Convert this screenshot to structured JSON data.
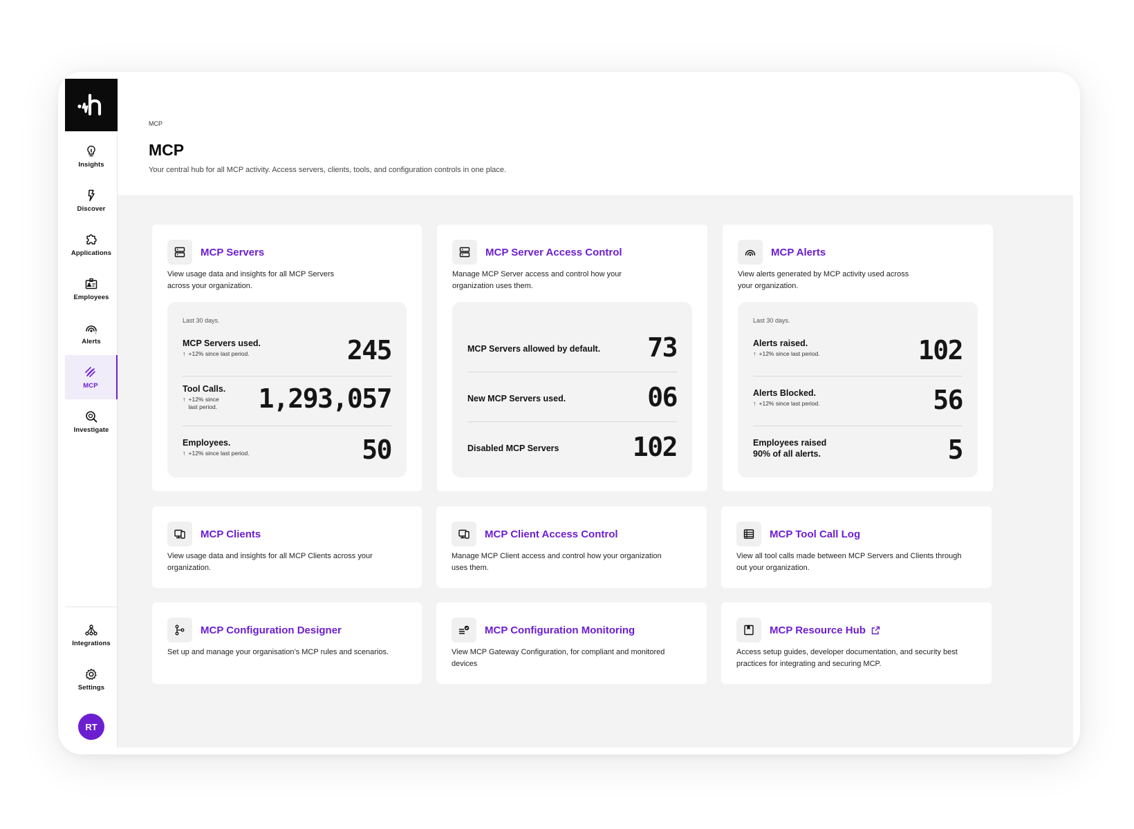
{
  "sidebar": {
    "items": [
      {
        "label": "Insights",
        "icon": "lightbulb-icon"
      },
      {
        "label": "Discover",
        "icon": "bolt-icon"
      },
      {
        "label": "Applications",
        "icon": "puzzle-icon"
      },
      {
        "label": "Employees",
        "icon": "id-card-icon"
      },
      {
        "label": "Alerts",
        "icon": "signal-icon"
      },
      {
        "label": "MCP",
        "icon": "mcp-icon",
        "active": true
      },
      {
        "label": "Investigate",
        "icon": "magnifier-icon"
      }
    ],
    "bottom": [
      {
        "label": "Integrations",
        "icon": "network-icon"
      },
      {
        "label": "Settings",
        "icon": "gear-icon"
      }
    ],
    "avatar": "RT"
  },
  "header": {
    "breadcrumb": "MCP",
    "title": "MCP",
    "subtitle": "Your central hub for all MCP activity. Access servers, clients, tools, and configuration controls in one place."
  },
  "cards": {
    "servers": {
      "title": "MCP Servers",
      "desc1": "View usage data and insights for all MCP Servers",
      "desc2": "across your organization.",
      "period": "Last 30 days.",
      "rows": [
        {
          "label": "MCP Servers used.",
          "sub": "+12% since last period.",
          "value": "245"
        },
        {
          "label": "Tool Calls.",
          "sub1": "+12% since",
          "sub2": "last period.",
          "value": "1,293,057"
        },
        {
          "label": "Employees.",
          "sub": "+12% since last period.",
          "value": "50"
        }
      ]
    },
    "access": {
      "title": "MCP Server Access Control",
      "desc1": "Manage MCP Server access and control how your",
      "desc2": "organization uses them.",
      "rows": [
        {
          "label": "MCP Servers allowed by default.",
          "value": "73"
        },
        {
          "label": "New MCP Servers used.",
          "value": "06"
        },
        {
          "label": "Disabled MCP Servers",
          "value": "102"
        }
      ]
    },
    "alerts": {
      "title": "MCP Alerts",
      "desc1": "View alerts generated by MCP activity used across",
      "desc2": "your organization.",
      "period": "Last 30 days.",
      "rows": [
        {
          "label": "Alerts raised.",
          "sub": "+12% since last period.",
          "value": "102"
        },
        {
          "label": "Alerts Blocked.",
          "sub": "+12% since last period.",
          "value": "56"
        },
        {
          "label1": "Employees raised",
          "label2": "90% of all alerts.",
          "value": "5"
        }
      ]
    },
    "clients": {
      "title": "MCP Clients",
      "desc1": "View usage data and insights for all MCP Clients across your",
      "desc2": "organization."
    },
    "client_access": {
      "title": "MCP Client Access Control",
      "desc1": "Manage MCP Client access and control how your organization",
      "desc2": "uses them."
    },
    "tool_log": {
      "title": "MCP Tool Call Log",
      "desc1": "View all tool calls made between MCP Servers and Clients through",
      "desc2": "out your organization."
    },
    "config_designer": {
      "title": "MCP Configuration Designer",
      "desc1": "Set up and manage your organisation’s MCP rules and scenarios."
    },
    "config_monitor": {
      "title": "MCP Configuration Monitoring",
      "desc1": "View MCP Gateway Configuration, for compliant and monitored",
      "desc2": "devices"
    },
    "resource_hub": {
      "title": "MCP Resource Hub",
      "desc1": "Access setup guides, developer documentation, and security best",
      "desc2": "practices for integrating and securing MCP."
    }
  },
  "colors": {
    "accent": "#6c1ed1",
    "background": "#f3f3f3",
    "logo_bg": "#0b0b0b"
  }
}
